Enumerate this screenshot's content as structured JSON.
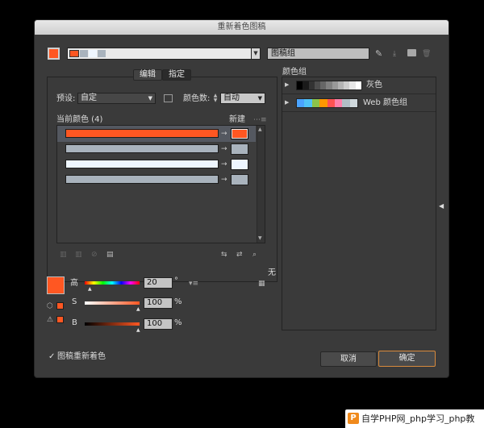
{
  "title": "重新着色图稿",
  "top": {
    "artwork_name": "图稿组",
    "current_swatch_color": "#ff5722"
  },
  "tabs": [
    {
      "label": "编辑"
    },
    {
      "label": "指定"
    }
  ],
  "preset": {
    "label": "预设:",
    "value": "自定"
  },
  "color_count": {
    "label": "颜色数:",
    "value": "自动"
  },
  "current_colors": {
    "label": "当前颜色 (4)",
    "new_label": "新建"
  },
  "color_rows": [
    {
      "current": "#ff5722",
      "new": "#ff5722",
      "selected": true
    },
    {
      "current": "#a9b3bd",
      "new": "#a9b3bd",
      "selected": false
    },
    {
      "current": "#eef6ff",
      "new": "#eef6ff",
      "selected": false
    },
    {
      "current": "#a9b3bd",
      "new": "#a9b3bd",
      "selected": false
    }
  ],
  "none_label": "无",
  "sliders": [
    {
      "label": "高",
      "value": "20",
      "unit": "°"
    },
    {
      "label": "S",
      "value": "100",
      "unit": "%"
    },
    {
      "label": "B",
      "value": "100",
      "unit": "%"
    }
  ],
  "selected_color": "#ff5722",
  "color_groups": {
    "header": "颜色组",
    "groups": [
      {
        "label": "灰色",
        "swatches": [
          "#000000",
          "#1a1a1a",
          "#333333",
          "#4d4d4d",
          "#666666",
          "#808080",
          "#999999",
          "#b3b3b3",
          "#cccccc",
          "#e6e6e6",
          "#ffffff"
        ]
      },
      {
        "label": "Web 颜色组",
        "swatches": [
          "#4aa3ff",
          "#4fc3f7",
          "#8bc34a",
          "#ff9800",
          "#ff5252",
          "#ff80ab",
          "#b0bec5",
          "#cfd8dc"
        ]
      }
    ]
  },
  "recolor_checkbox": {
    "label": "图稿重新着色",
    "checked": true
  },
  "buttons": {
    "cancel": "取消",
    "ok": "确定"
  },
  "watermark": {
    "text": "自学PHP网_php学习_php教"
  }
}
